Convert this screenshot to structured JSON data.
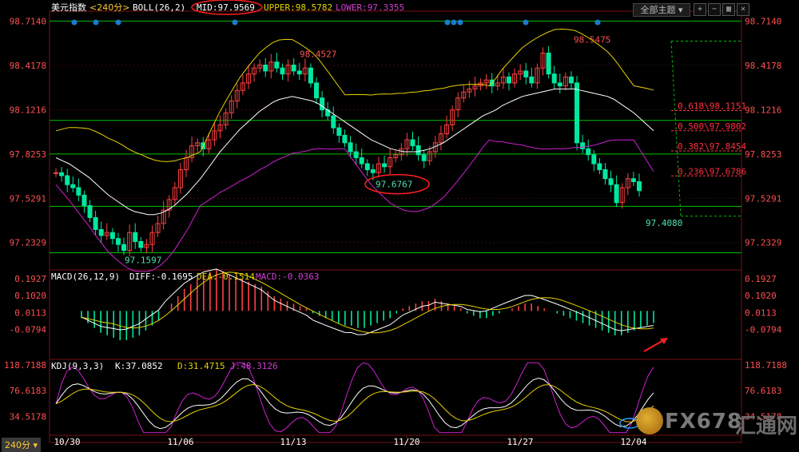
{
  "header": {
    "name": "美元指数",
    "period": "<240分>",
    "indicator": "BOLL(26,2)",
    "mid": "MID:97.9569",
    "upper": "UPPER:98.5782",
    "lower": "LOWER:97.3355"
  },
  "macd_header": {
    "name": "MACD(26,12,9)",
    "diff": "DIFF:-0.1695",
    "dea": "DEA:-0.1514",
    "macd": "MACD:-0.0363"
  },
  "kdj_header": {
    "name": "KDJ(9,3,3)",
    "k": "K:37.0852",
    "d": "D:31.4715",
    "j": "J:48.3126"
  },
  "toolbar": {
    "theme_label": "全部主题",
    "period_label": "240分"
  },
  "watermark": {
    "brand": "FX678",
    "cn": "汇通网"
  },
  "colors": {
    "up": "#ff4040",
    "down": "#00e8a0",
    "mid": "#ffffff",
    "upper": "#e6d200",
    "lower": "#d020d0",
    "grid": "#00c000",
    "fib": "#ff3040"
  },
  "chart_data": [
    {
      "type": "candlestick",
      "axis_ticks": [
        "98.7140",
        "98.4178",
        "98.1216",
        "97.8253",
        "97.5291",
        "97.2329"
      ],
      "ylim": [
        97.05,
        98.78
      ],
      "x_ticks": [
        "10/30",
        "11/06",
        "11/13",
        "11/20",
        "11/27",
        "12/04"
      ],
      "price_labels": [
        {
          "text": "98.4527",
          "value": 98.4527
        },
        {
          "text": "97.6767",
          "value": 97.6767
        },
        {
          "text": "97.1597",
          "value": 97.1597
        },
        {
          "text": "98.5475",
          "value": 98.5475
        },
        {
          "text": "97.4080",
          "value": 97.408
        }
      ],
      "horizontal_levels": [
        98.714,
        98.05,
        97.825,
        97.475,
        97.165
      ],
      "fibonacci": [
        {
          "text": "0.618\\98.1151",
          "value": 98.1151
        },
        {
          "text": "0.500\\97.9802",
          "value": 97.9802
        },
        {
          "text": "0.382\\97.8454",
          "value": 97.8454
        },
        {
          "text": "0.236\\97.6786",
          "value": 97.6786
        }
      ],
      "close_series": [
        97.7,
        97.68,
        97.62,
        97.6,
        97.55,
        97.48,
        97.4,
        97.32,
        97.28,
        97.3,
        97.26,
        97.22,
        97.18,
        97.3,
        97.24,
        97.2,
        97.22,
        97.3,
        97.36,
        97.45,
        97.52,
        97.6,
        97.72,
        97.8,
        97.88,
        97.9,
        97.86,
        97.92,
        97.98,
        98.02,
        98.1,
        98.18,
        98.25,
        98.3,
        98.36,
        98.4,
        98.42,
        98.38,
        98.44,
        98.4,
        98.36,
        98.42,
        98.38,
        98.36,
        98.4,
        98.3,
        98.2,
        98.12,
        98.08,
        98.0,
        97.95,
        97.9,
        97.84,
        97.8,
        97.76,
        97.72,
        97.7,
        97.76,
        97.74,
        97.8,
        97.82,
        97.86,
        97.92,
        97.88,
        97.82,
        97.78,
        97.84,
        97.9,
        97.96,
        98.02,
        98.12,
        98.2,
        98.24,
        98.26,
        98.28,
        98.3,
        98.32,
        98.28,
        98.3,
        98.34,
        98.3,
        98.36,
        98.38,
        98.34,
        98.3,
        98.4,
        98.5,
        98.36,
        98.3,
        98.28,
        98.34,
        98.3,
        97.9,
        97.86,
        97.82,
        97.76,
        97.72,
        97.66,
        97.62,
        97.5,
        97.6,
        97.66,
        97.64,
        97.58
      ],
      "mid_series": [
        97.8,
        97.78,
        97.76,
        97.73,
        97.7,
        97.67,
        97.63,
        97.59,
        97.55,
        97.52,
        97.49,
        97.46,
        97.44,
        97.43,
        97.42,
        97.42,
        97.43,
        97.45,
        97.48,
        97.52,
        97.56,
        97.61,
        97.66,
        97.72,
        97.78,
        97.84,
        97.89,
        97.94,
        97.99,
        98.03,
        98.07,
        98.11,
        98.14,
        98.17,
        98.19,
        98.2,
        98.21,
        98.2,
        98.19,
        98.18,
        98.16,
        98.13,
        98.1,
        98.07,
        98.04,
        98.01,
        97.98,
        97.95,
        97.92,
        97.9,
        97.88,
        97.86,
        97.85,
        97.84,
        97.84,
        97.84,
        97.85,
        97.86,
        97.88,
        97.9,
        97.93,
        97.96,
        97.99,
        98.02,
        98.05,
        98.08,
        98.1,
        98.12,
        98.15,
        98.17,
        98.19,
        98.21,
        98.22,
        98.23,
        98.24,
        98.25,
        98.26,
        98.26,
        98.26,
        98.26,
        98.25,
        98.24,
        98.23,
        98.22,
        98.21,
        98.19,
        98.16,
        98.13,
        98.1,
        98.06,
        98.02,
        97.98
      ]
    },
    {
      "type": "bar",
      "name": "MACD",
      "axis_ticks": [
        "0.1927",
        "0.1020",
        "0.0113",
        "-0.0794"
      ],
      "ylim": [
        -0.23,
        0.23
      ],
      "histogram": [
        -0.03,
        -0.05,
        -0.07,
        -0.09,
        -0.1,
        -0.11,
        -0.12,
        -0.12,
        -0.11,
        -0.1,
        -0.08,
        -0.06,
        -0.04,
        0.0,
        0.03,
        0.06,
        0.09,
        0.11,
        0.13,
        0.15,
        0.16,
        0.17,
        0.16,
        0.15,
        0.14,
        0.13,
        0.12,
        0.11,
        0.1,
        0.08,
        0.06,
        0.05,
        0.04,
        0.03,
        0.02,
        0.01,
        -0.01,
        -0.02,
        -0.03,
        -0.04,
        -0.05,
        -0.06,
        -0.06,
        -0.07,
        -0.07,
        -0.06,
        -0.05,
        -0.04,
        -0.03,
        -0.01,
        0.01,
        0.02,
        0.03,
        0.04,
        0.04,
        0.05,
        0.04,
        0.03,
        0.02,
        0.01,
        -0.01,
        -0.02,
        -0.03,
        -0.03,
        -0.02,
        -0.01,
        0.0,
        0.01,
        0.02,
        0.03,
        0.03,
        0.02,
        0.01,
        0.0,
        -0.01,
        -0.02,
        -0.03,
        -0.04,
        -0.05,
        -0.06,
        -0.07,
        -0.08,
        -0.09,
        -0.1,
        -0.1,
        -0.09,
        -0.08,
        -0.07,
        -0.06,
        -0.05
      ]
    },
    {
      "type": "line",
      "name": "KDJ",
      "axis_ticks": [
        "118.7188",
        "76.6183",
        "34.5178"
      ],
      "ylim": [
        5,
        125
      ]
    }
  ]
}
